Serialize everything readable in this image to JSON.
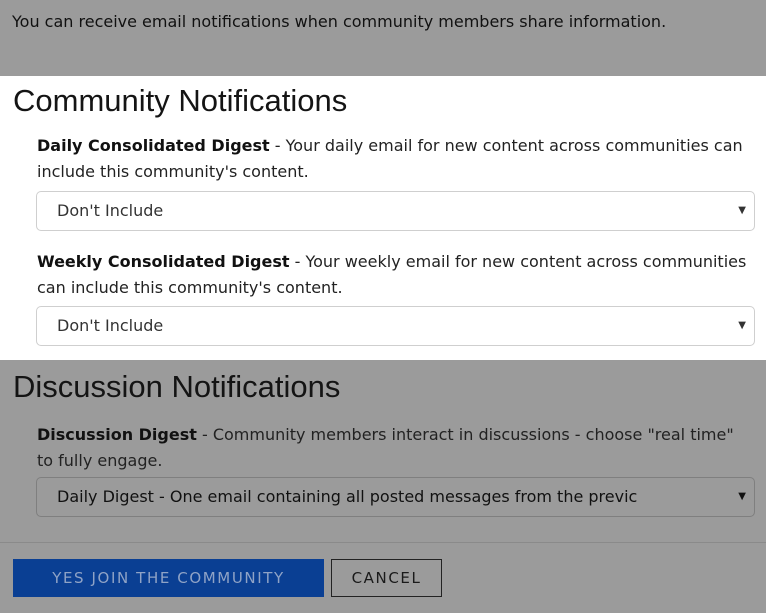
{
  "intro": {
    "text": "You can receive email notifications when community members share information."
  },
  "community": {
    "title": "Community Notifications",
    "daily": {
      "label": "Daily Consolidated Digest",
      "desc": " - Your daily email for new content across communities can include this community's content.",
      "selected": "Don't Include"
    },
    "weekly": {
      "label": "Weekly Consolidated Digest",
      "desc": " - Your weekly email for new content across communities can include this community's content.",
      "selected": "Don't Include"
    }
  },
  "discussion": {
    "title": "Discussion Notifications",
    "digest": {
      "label": "Discussion Digest",
      "desc": " - Community members interact in discussions - choose \"real time\" to fully engage.",
      "selected": "Daily Digest - One email containing all posted messages from the previc"
    }
  },
  "footer": {
    "join_label": "YES JOIN THE COMMUNITY",
    "cancel_label": "CANCEL"
  },
  "icons": {
    "caret": "caret-down-icon"
  },
  "colors": {
    "primary_button": "#0a3f93",
    "overlay": "#9b9b9b"
  }
}
